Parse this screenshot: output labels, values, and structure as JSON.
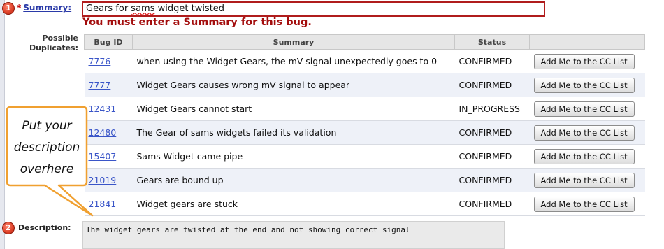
{
  "summary": {
    "step": "1",
    "required_mark": "*",
    "label": "Summary:",
    "value_before": "Gears for ",
    "value_misspelled": "sams",
    "value_after": " widget twisted",
    "error": "You must enter a Summary for this bug."
  },
  "duplicates": {
    "label_line1": "Possible",
    "label_line2": "Duplicates:",
    "headers": [
      "Bug ID",
      "Summary",
      "Status",
      ""
    ],
    "button_label": "Add Me to the CC List",
    "rows": [
      {
        "id": "7776",
        "summary": "when using the Widget Gears, the mV signal unexpectedly goes to 0",
        "status": "CONFIRMED"
      },
      {
        "id": "7777",
        "summary": "Widget Gears causes wrong mV signal to appear",
        "status": "CONFIRMED"
      },
      {
        "id": "12431",
        "summary": "Widget Gears cannot start",
        "status": "IN_PROGRESS"
      },
      {
        "id": "12480",
        "summary": "The Gear of sams widgets failed its validation",
        "status": "CONFIRMED"
      },
      {
        "id": "15407",
        "summary": "Sams Widget came pipe",
        "status": "CONFIRMED"
      },
      {
        "id": "21019",
        "summary": "Gears are bound up",
        "status": "CONFIRMED"
      },
      {
        "id": "21841",
        "summary": "Widget gears are stuck",
        "status": "CONFIRMED"
      }
    ]
  },
  "callout": {
    "line1": "Put your",
    "line2": "description",
    "line3": "overhere"
  },
  "description": {
    "step": "2",
    "label": "Description:",
    "value": "The widget gears are twisted at the end and not showing correct signal"
  },
  "colors": {
    "error": "#a30d0d",
    "link": "#2a3aa8",
    "callout_border": "#f0a030",
    "marker": "#e0442c"
  }
}
